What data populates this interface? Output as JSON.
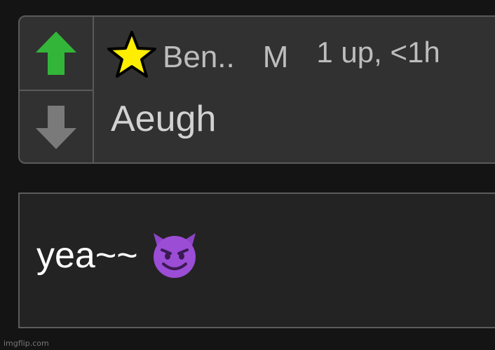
{
  "comment": {
    "username": "Ben..",
    "role_badge": "M",
    "vote_info": "1 up, <1h",
    "text": "Aeugh",
    "upvote_color": "#33b53a",
    "downvote_color": "#7a7a7a",
    "star_color": "#ffee00"
  },
  "reply_box": {
    "text": "yea~~",
    "emoji_icon": "smiling-devil-icon"
  },
  "watermark": "imgflip.com"
}
